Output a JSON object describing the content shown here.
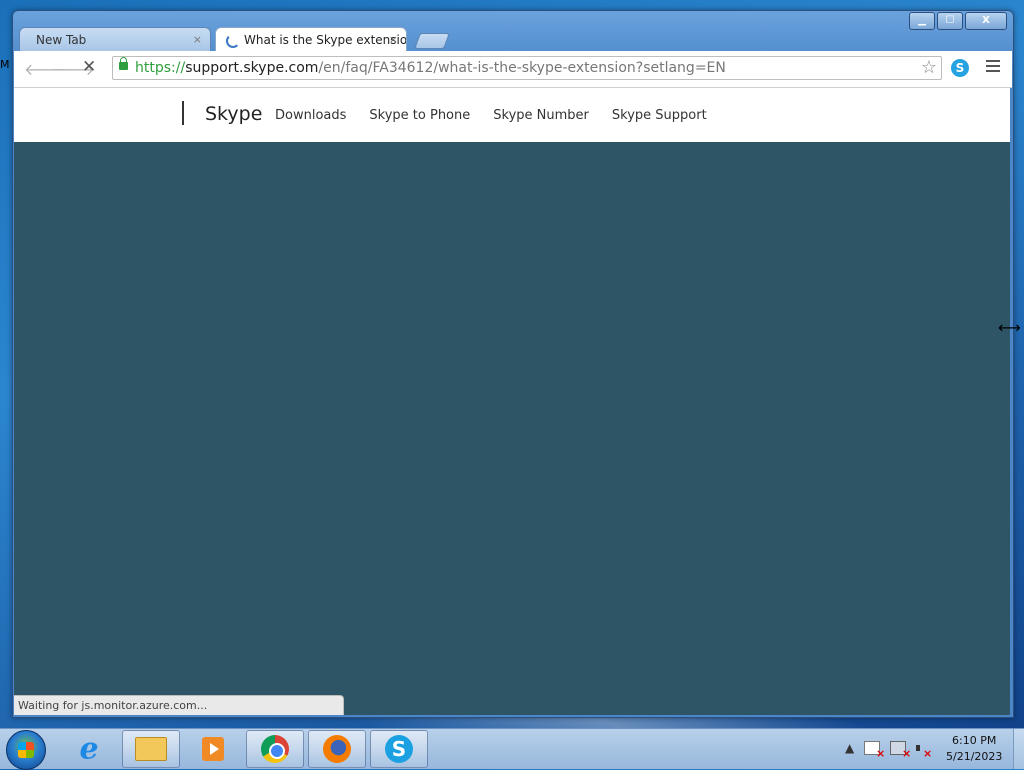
{
  "desktop": {
    "edge_text": "M"
  },
  "window": {
    "controls": {
      "minimize": "▁",
      "maximize": "☐",
      "close": "X"
    }
  },
  "tabs": [
    {
      "title": "New Tab",
      "close": "×"
    },
    {
      "title": "What is the Skype extensio",
      "close": "×"
    }
  ],
  "toolbar": {
    "url_scheme": "https://",
    "url_host": "support.skype.com",
    "url_path": "/en/faq/FA34612/what-is-the-skype-extension?setlang=EN",
    "icons": [
      "back-icon",
      "forward-icon",
      "stop-icon",
      "lock-icon",
      "star-icon",
      "skype-extension-icon",
      "menu-icon"
    ]
  },
  "site": {
    "brand": "Skype",
    "nav": [
      "Downloads",
      "Skype to Phone",
      "Skype Number",
      "Skype Support"
    ],
    "background_color": "#2e5566"
  },
  "status": {
    "text": "Waiting for js.monitor.azure.com..."
  },
  "taskbar": {
    "items": [
      "start-button",
      "internet-explorer",
      "windows-explorer",
      "media-player",
      "chrome",
      "firefox",
      "skype"
    ],
    "tray_arrow": "▲",
    "clock_time": "6:10 PM",
    "clock_date": "5/21/2023"
  }
}
